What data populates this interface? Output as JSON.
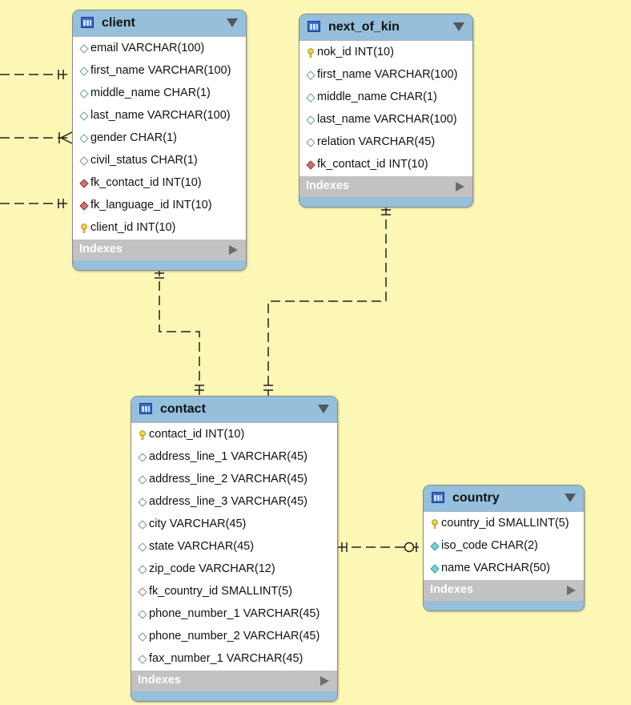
{
  "tables": [
    {
      "id": "client",
      "title": "client",
      "columns": [
        {
          "text": "email VARCHAR(100)",
          "key": "column"
        },
        {
          "text": "first_name VARCHAR(100)",
          "key": "column"
        },
        {
          "text": "middle_name CHAR(1)",
          "key": "column"
        },
        {
          "text": "last_name VARCHAR(100)",
          "key": "column"
        },
        {
          "text": "gender CHAR(1)",
          "key": "column"
        },
        {
          "text": "civil_status CHAR(1)",
          "key": "column"
        },
        {
          "text": "fk_contact_id INT(10)",
          "key": "foreign-key"
        },
        {
          "text": "fk_language_id INT(10)",
          "key": "foreign-key"
        },
        {
          "text": "client_id INT(10)",
          "key": "primary-key"
        }
      ],
      "indexes_label": "Indexes"
    },
    {
      "id": "next_of_kin",
      "title": "next_of_kin",
      "columns": [
        {
          "text": "nok_id INT(10)",
          "key": "primary-key"
        },
        {
          "text": "first_name VARCHAR(100)",
          "key": "column"
        },
        {
          "text": "middle_name CHAR(1)",
          "key": "column"
        },
        {
          "text": "last_name VARCHAR(100)",
          "key": "column"
        },
        {
          "text": "relation VARCHAR(45)",
          "key": "column"
        },
        {
          "text": "fk_contact_id INT(10)",
          "key": "foreign-key"
        }
      ],
      "indexes_label": "Indexes"
    },
    {
      "id": "contact",
      "title": "contact",
      "columns": [
        {
          "text": "contact_id INT(10)",
          "key": "primary-key"
        },
        {
          "text": "address_line_1 VARCHAR(45)",
          "key": "column"
        },
        {
          "text": "address_line_2 VARCHAR(45)",
          "key": "column"
        },
        {
          "text": "address_line_3 VARCHAR(45)",
          "key": "column"
        },
        {
          "text": "city VARCHAR(45)",
          "key": "column"
        },
        {
          "text": "state VARCHAR(45)",
          "key": "column"
        },
        {
          "text": "zip_code VARCHAR(12)",
          "key": "column"
        },
        {
          "text": "fk_country_id SMALLINT(5)",
          "key": "foreign-key-nullable"
        },
        {
          "text": "phone_number_1 VARCHAR(45)",
          "key": "column"
        },
        {
          "text": "phone_number_2 VARCHAR(45)",
          "key": "column"
        },
        {
          "text": "fax_number_1 VARCHAR(45)",
          "key": "column"
        }
      ],
      "indexes_label": "Indexes"
    },
    {
      "id": "country",
      "title": "country",
      "columns": [
        {
          "text": "country_id SMALLINT(5)",
          "key": "primary-key"
        },
        {
          "text": "iso_code CHAR(2)",
          "key": "column-not-null"
        },
        {
          "text": "name VARCHAR(50)",
          "key": "column-not-null"
        }
      ],
      "indexes_label": "Indexes"
    }
  ],
  "relationships": [
    {
      "from": "client",
      "to": "contact",
      "cardinality": "one-to-one"
    },
    {
      "from": "next_of_kin",
      "to": "contact",
      "cardinality": "one-to-one"
    },
    {
      "from": "contact",
      "to": "country",
      "cardinality": "one-to-zero-or-one"
    },
    {
      "from": "client",
      "to": "offscreen",
      "cardinality": "one"
    },
    {
      "from": "client",
      "to": "offscreen",
      "cardinality": "one-or-many"
    },
    {
      "from": "client",
      "to": "offscreen",
      "cardinality": "one"
    }
  ],
  "colors": {
    "background": "#fcf7b4",
    "header": "#95bfdb",
    "indexes_bar": "#c2c2c2",
    "primary_key": "#f2d544",
    "foreign_key": "#d46e6e",
    "column": "#8ab8c8",
    "column_not_null": "#6fd2df"
  }
}
